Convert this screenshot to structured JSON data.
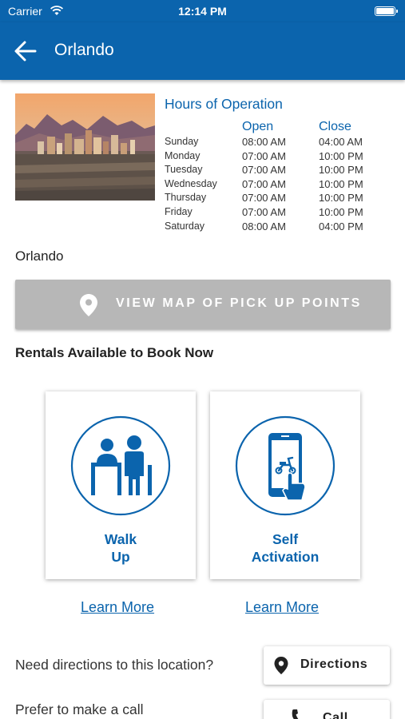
{
  "status_bar": {
    "carrier": "Carrier",
    "time": "12:14 PM"
  },
  "nav": {
    "title": "Orlando"
  },
  "hours": {
    "title": "Hours of Operation",
    "open_header": "Open",
    "close_header": "Close",
    "rows": [
      {
        "day": "Sunday",
        "open": "08:00 AM",
        "close": "04:00 AM"
      },
      {
        "day": "Monday",
        "open": "07:00 AM",
        "close": "10:00 PM"
      },
      {
        "day": "Tuesday",
        "open": "07:00 AM",
        "close": "10:00 PM"
      },
      {
        "day": "Wednesday",
        "open": "07:00 AM",
        "close": "10:00 PM"
      },
      {
        "day": "Thursday",
        "open": "07:00 AM",
        "close": "10:00 PM"
      },
      {
        "day": "Friday",
        "open": "07:00 AM",
        "close": "10:00 PM"
      },
      {
        "day": "Saturday",
        "open": "08:00 AM",
        "close": "04:00 PM"
      }
    ]
  },
  "location_name": "Orlando",
  "map_button": {
    "label": "VIEW MAP OF PICK UP POINTS"
  },
  "rentals": {
    "title": "Rentals Available to Book Now",
    "cards": [
      {
        "line1": "Walk",
        "line2": "Up",
        "icon": "walk-up-counter-icon",
        "learn_more": "Learn More"
      },
      {
        "line1": "Self",
        "line2": "Activation",
        "icon": "phone-scooter-icon",
        "learn_more": "Learn More"
      }
    ]
  },
  "directions": {
    "prompt": "Need directions to this location?",
    "button": "Directions"
  },
  "call": {
    "prompt": "Prefer to make a call",
    "button": "Call"
  },
  "colors": {
    "brand": "#0b64ad",
    "map_button": "#b7b7b7"
  }
}
